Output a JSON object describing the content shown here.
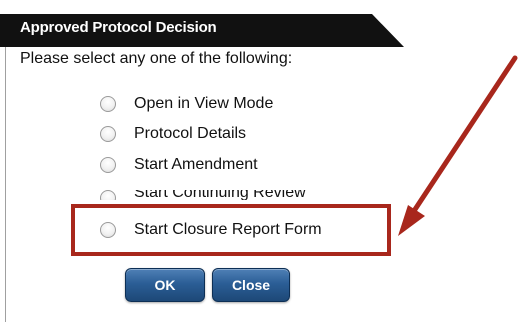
{
  "dialog": {
    "title": "Approved Protocol Decision",
    "prompt": "Please select any one of the following:",
    "options": [
      {
        "label": "Open in View Mode"
      },
      {
        "label": "Protocol Details"
      },
      {
        "label": "Start Amendment"
      },
      {
        "label": "Start Continuing Review"
      },
      {
        "label": "Start Closure Report Form"
      }
    ],
    "buttons": {
      "ok": "OK",
      "close": "Close"
    }
  },
  "colors": {
    "title_bar": "#111111",
    "highlight": "#a8271c",
    "button": "#2b5e96"
  }
}
